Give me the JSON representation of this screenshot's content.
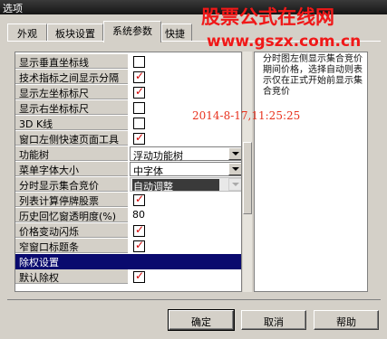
{
  "window": {
    "title": "选项"
  },
  "watermark": {
    "line1": "股票公式在线网",
    "line2": "www.gszx.com.cn",
    "stamp": "2014-8-17,11:25:25"
  },
  "tabs": [
    "外观",
    "板块设置",
    "系统参数",
    "快捷"
  ],
  "active_tab": "系统参数",
  "settings": [
    {
      "label": "显示垂直坐标线",
      "type": "checkbox",
      "checked": false
    },
    {
      "label": "技术指标之间显示分隔",
      "type": "checkbox",
      "checked": true
    },
    {
      "label": "显示左坐标标尺",
      "type": "checkbox",
      "checked": true
    },
    {
      "label": "显示右坐标标尺",
      "type": "checkbox",
      "checked": false
    },
    {
      "label": "3D K线",
      "type": "checkbox",
      "checked": false
    },
    {
      "label": "窗口左侧快速页面工具",
      "type": "checkbox",
      "checked": true
    },
    {
      "label": "功能树",
      "type": "select",
      "value": "浮动功能树"
    },
    {
      "label": "菜单字体大小",
      "type": "select",
      "value": "中字体"
    },
    {
      "label": "分时显示集合竞价",
      "type": "select",
      "value": "自动调整",
      "highlighted": true
    },
    {
      "label": "列表计算停牌股票",
      "type": "checkbox",
      "checked": true
    },
    {
      "label": "历史回忆窗透明度(%)",
      "type": "text",
      "value": "80"
    },
    {
      "label": "价格变动闪烁",
      "type": "checkbox",
      "checked": true
    },
    {
      "label": "窄窗口标题条",
      "type": "checkbox",
      "checked": true
    }
  ],
  "section_header": "除权设置",
  "partial_row": {
    "label": "默认除权",
    "checked": true
  },
  "description": "分时图左侧显示集合竞价期间价格，选择自动则表示仅在正式开始前显示集合竞价",
  "buttons": {
    "ok": "确定",
    "cancel": "取消",
    "help": "帮助"
  },
  "colors": {
    "watermark": "#f01818",
    "check": "#d00000",
    "section": "#0a0a6e",
    "titlebar": "#1e1e1e"
  }
}
